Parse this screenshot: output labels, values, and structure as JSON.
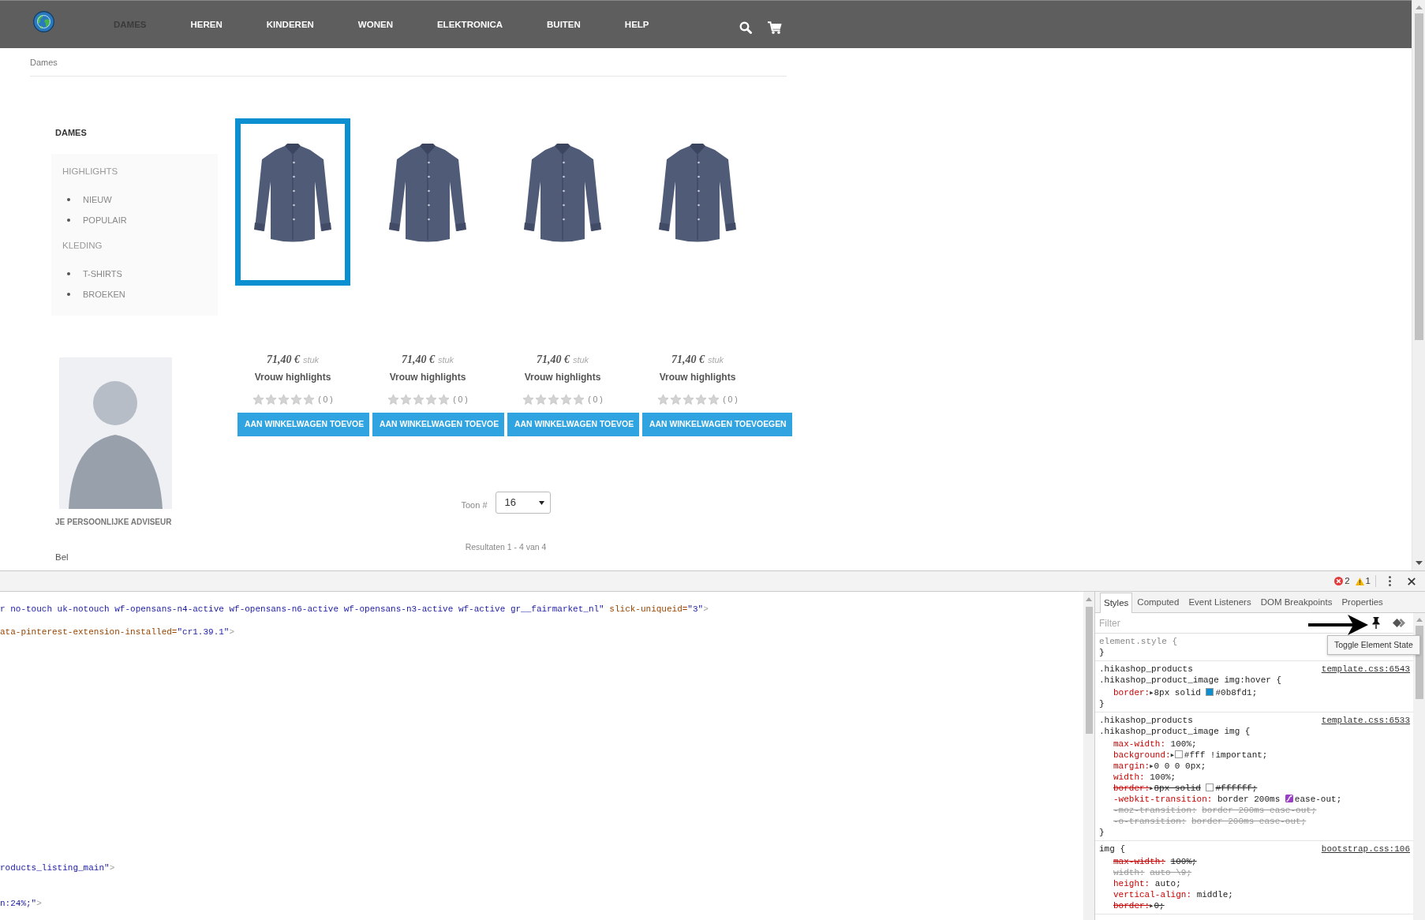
{
  "nav": {
    "items": [
      {
        "label": "DAMES",
        "selected": true
      },
      {
        "label": "HEREN",
        "selected": false
      },
      {
        "label": "KINDEREN",
        "selected": false
      },
      {
        "label": "WONEN",
        "selected": false
      },
      {
        "label": "ELEKTRONICA",
        "selected": false
      },
      {
        "label": "BUITEN",
        "selected": false
      },
      {
        "label": "HELP",
        "selected": false
      }
    ]
  },
  "breadcrumb": [
    "Dames"
  ],
  "sidebar": {
    "title": "DAMES",
    "groups": [
      {
        "label": "HIGHLIGHTS",
        "items": [
          "NIEUW",
          "POPULAIR"
        ]
      },
      {
        "label": "KLEDING",
        "items": [
          "T-SHIRTS",
          "BROEKEN"
        ]
      }
    ]
  },
  "adviser": {
    "title": "JE PERSOONLIJKE ADVISEUR",
    "contact_label": "Bel"
  },
  "products": [
    {
      "price": "71,40 €",
      "unit": "stuk",
      "name": "Vrouw highlights",
      "stars": 0,
      "reviews": "( 0 )",
      "button": "AAN WINKELWAGEN TOEVOE",
      "hovered": true
    },
    {
      "price": "71,40 €",
      "unit": "stuk",
      "name": "Vrouw highlights",
      "stars": 0,
      "reviews": "( 0 )",
      "button": "AAN WINKELWAGEN TOEVOE",
      "hovered": false
    },
    {
      "price": "71,40 €",
      "unit": "stuk",
      "name": "Vrouw highlights",
      "stars": 0,
      "reviews": "( 0 )",
      "button": "AAN WINKELWAGEN TOEVOE",
      "hovered": false
    },
    {
      "price": "71,40 €",
      "unit": "stuk",
      "name": "Vrouw highlights",
      "stars": 0,
      "reviews": "( 0 )",
      "button": "AAN WINKELWAGEN TOEVOEGEN",
      "hovered": false
    }
  ],
  "listing": {
    "show_label": "Toon #",
    "page_size": "16",
    "results": "Resultaten 1 - 4 van 4"
  },
  "devtools": {
    "errors": "2",
    "warnings": "1",
    "dom_lines": [
      {
        "tokens": [
          {
            "kind": "value",
            "text": "r no-touch uk-notouch wf-opensans-n4-active wf-opensans-n6-active wf-opensans-n3-active wf-active gr__fairmarket_nl\""
          },
          {
            "kind": "attr",
            "text": "slick-uniqueid="
          },
          {
            "kind": "value",
            "text": "\"3\""
          },
          {
            "kind": "punct",
            "text": ">"
          }
        ]
      },
      {
        "tokens": [
          {
            "kind": "attr",
            "text": "ata-pinterest-extension-installed="
          },
          {
            "kind": "value",
            "text": "\"cr1.39.1\""
          },
          {
            "kind": "punct",
            "text": ">"
          }
        ]
      },
      {
        "tokens": [
          {
            "kind": "value",
            "text": "roducts_listing_main\""
          },
          {
            "kind": "punct",
            "text": ">"
          }
        ]
      },
      {
        "tokens": [
          {
            "kind": "value",
            "text": "n:24%;\""
          },
          {
            "kind": "punct",
            "text": ">"
          }
        ]
      }
    ],
    "styles_tabs": [
      {
        "label": "Styles",
        "selected": true
      },
      {
        "label": "Computed",
        "selected": false
      },
      {
        "label": "Event Listeners",
        "selected": false
      },
      {
        "label": "DOM Breakpoints",
        "selected": false
      },
      {
        "label": "Properties",
        "selected": false
      }
    ],
    "filter": {
      "placeholder": "Filter"
    },
    "tooltip": "Toggle Element State",
    "rules": [
      {
        "kind": "inline",
        "selectors": [
          "element.style {"
        ],
        "close": "}"
      },
      {
        "kind": "rule",
        "selectors": [
          ".hikashop_products",
          ".hikashop_product_image img:hover {"
        ],
        "source": "template.css:6543",
        "properties": [
          {
            "name": "border:",
            "value": [
              {
                "kind": "expander",
                "text": "▶"
              },
              {
                "kind": "text",
                "text": "8px solid"
              },
              {
                "kind": "swatch",
                "color": "#0b8fd1"
              },
              {
                "kind": "text",
                "text": "#0b8fd1;"
              }
            ],
            "overridden": false,
            "supported": true
          }
        ],
        "close": "}"
      },
      {
        "kind": "rule",
        "selectors": [
          ".hikashop_products",
          ".hikashop_product_image img {"
        ],
        "source": "template.css:6533",
        "properties": [
          {
            "name": "max-width:",
            "value": [
              {
                "kind": "text",
                "text": "100%;"
              }
            ],
            "overridden": false,
            "supported": true
          },
          {
            "name": "background:",
            "value": [
              {
                "kind": "expander",
                "text": "▶"
              },
              {
                "kind": "swatch",
                "color": "#ffffff"
              },
              {
                "kind": "text",
                "text": "#fff !important;"
              }
            ],
            "overridden": false,
            "supported": true
          },
          {
            "name": "margin:",
            "value": [
              {
                "kind": "expander",
                "text": "▶"
              },
              {
                "kind": "text",
                "text": "0 0 0 0px;"
              }
            ],
            "overridden": false,
            "supported": true
          },
          {
            "name": "width:",
            "value": [
              {
                "kind": "text",
                "text": "100%;"
              }
            ],
            "overridden": false,
            "supported": true
          },
          {
            "name": "border:",
            "value": [
              {
                "kind": "expander",
                "text": "▶"
              },
              {
                "kind": "text",
                "text": "8px solid"
              },
              {
                "kind": "swatch",
                "color": "#ffffff"
              },
              {
                "kind": "text",
                "text": "#ffffff;"
              }
            ],
            "overridden": true,
            "supported": true
          },
          {
            "name": "-webkit-transition:",
            "value": [
              {
                "kind": "text",
                "text": "border 200ms"
              },
              {
                "kind": "easing"
              },
              {
                "kind": "text",
                "text": "ease-out;"
              }
            ],
            "overridden": false,
            "supported": true
          },
          {
            "name": "-moz-transition:",
            "value": [
              {
                "kind": "text",
                "text": "border 200ms ease-out;"
              }
            ],
            "overridden": true,
            "supported": false
          },
          {
            "name": "-o-transition:",
            "value": [
              {
                "kind": "text",
                "text": "border 200ms ease-out;"
              }
            ],
            "overridden": true,
            "supported": false
          }
        ],
        "close": "}"
      },
      {
        "kind": "rule",
        "selectors": [
          "img {"
        ],
        "source": "bootstrap.css:106",
        "properties": [
          {
            "name": "max-width:",
            "value": [
              {
                "kind": "text",
                "text": "100%;"
              }
            ],
            "overridden": true,
            "supported": true
          },
          {
            "name": "width:",
            "value": [
              {
                "kind": "text",
                "text": "auto \\9;"
              }
            ],
            "overridden": true,
            "supported": false
          },
          {
            "name": "height:",
            "value": [
              {
                "kind": "text",
                "text": "auto;"
              }
            ],
            "overridden": false,
            "supported": true
          },
          {
            "name": "vertical-align:",
            "value": [
              {
                "kind": "text",
                "text": "middle;"
              }
            ],
            "overridden": false,
            "supported": true
          },
          {
            "name": "border:",
            "value": [
              {
                "kind": "expander",
                "text": "▶"
              },
              {
                "kind": "text",
                "text": "0;"
              }
            ],
            "overridden": true,
            "supported": true
          }
        ]
      }
    ]
  }
}
